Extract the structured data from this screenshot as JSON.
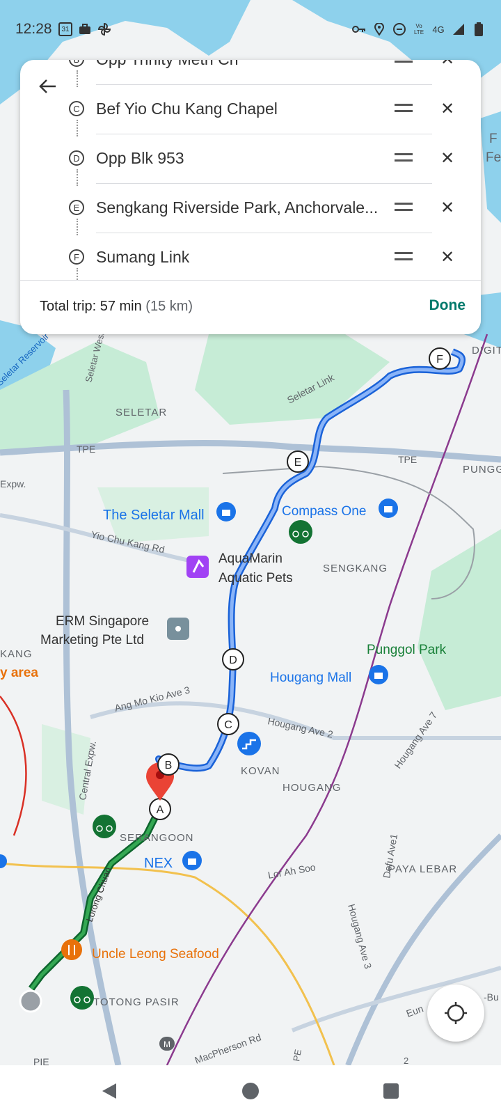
{
  "status_bar": {
    "time": "12:28",
    "calendar_day": "31",
    "network": "4G",
    "volte": "Vo LTE",
    "icons": [
      "calendar-icon",
      "work-profile-icon",
      "pinwheel-icon",
      "key-icon",
      "location-icon",
      "dnd-icon",
      "signal-icon",
      "battery-icon"
    ]
  },
  "route_panel": {
    "stops": [
      {
        "letter": "B",
        "name": "Opp Trinity Meth Ch"
      },
      {
        "letter": "C",
        "name": "Bef Yio Chu Kang Chapel"
      },
      {
        "letter": "D",
        "name": "Opp Blk 953"
      },
      {
        "letter": "E",
        "name": "Sengkang Riverside Park, Anchorvale..."
      },
      {
        "letter": "F",
        "name": "Sumang Link"
      }
    ],
    "total_label": "Total trip: 57 min",
    "distance": "(15 km)",
    "done_label": "Done"
  },
  "map": {
    "places": {
      "seletar_mall": "The Seletar Mall",
      "compass_one": "Compass One",
      "aquamarin_1": "AquaMarin",
      "aquamarin_2": "Aquatic Pets",
      "erm_1": "ERM Singapore",
      "erm_2": "Marketing Pte Ltd",
      "punggol_park": "Punggol Park",
      "hougang_mall": "Hougang Mall",
      "nex": "NEX",
      "uncle_leong": "Uncle Leong Seafood"
    },
    "areas": {
      "seletar": "SELETAR",
      "sengkang": "SENGKANG",
      "kovan": "KOVAN",
      "hougang": "HOUGANG",
      "serangoon": "SERANGOON",
      "paya_lebar": "PAYA LEBAR",
      "toa_payoh": "TOTONG PASIR",
      "punggol": "PUNGG",
      "digital": "DIGIT",
      "kang": "KANG",
      "fe_1": "F",
      "fe_2": "Fe",
      "y_area": "y area"
    },
    "roads": {
      "seletar_link": "Seletar Link",
      "tpe": "TPE",
      "tpe2": "TPE",
      "yck_rd": "Yio Chu Kang Rd",
      "amk_ave3": "Ang Mo Kio Ave 3",
      "hougang_ave2": "Hougang Ave 2",
      "hougang_ave7": "Hougang Ave 7",
      "defu_ave1": "Defu Ave1",
      "hougang_ave3": "Hougang Ave 3",
      "lor_ah_soo": "Lor Ah Soo",
      "central_expw": "Central Expw.",
      "lorong_chuan": "Lorong Chuan",
      "macpherson": "MacPherson Rd",
      "seletar_west": "Seletar West",
      "seletar_reservoir": "Seletar Reservoir",
      "pie": "PIE",
      "expw": "Expw.",
      "eunos": "Eun",
      "bukit": "-Bu",
      "pe": "PE",
      "lim2": "2"
    },
    "markers": [
      "A",
      "B",
      "C",
      "D",
      "E",
      "F"
    ],
    "mrt": "M"
  },
  "colors": {
    "route": "#4285f4",
    "route_outline": "#1a62d8",
    "green_route": "#188038",
    "done": "#00796b",
    "water": "#8ed1ec",
    "park": "#c6ecd6",
    "land": "#f1f3f4"
  }
}
